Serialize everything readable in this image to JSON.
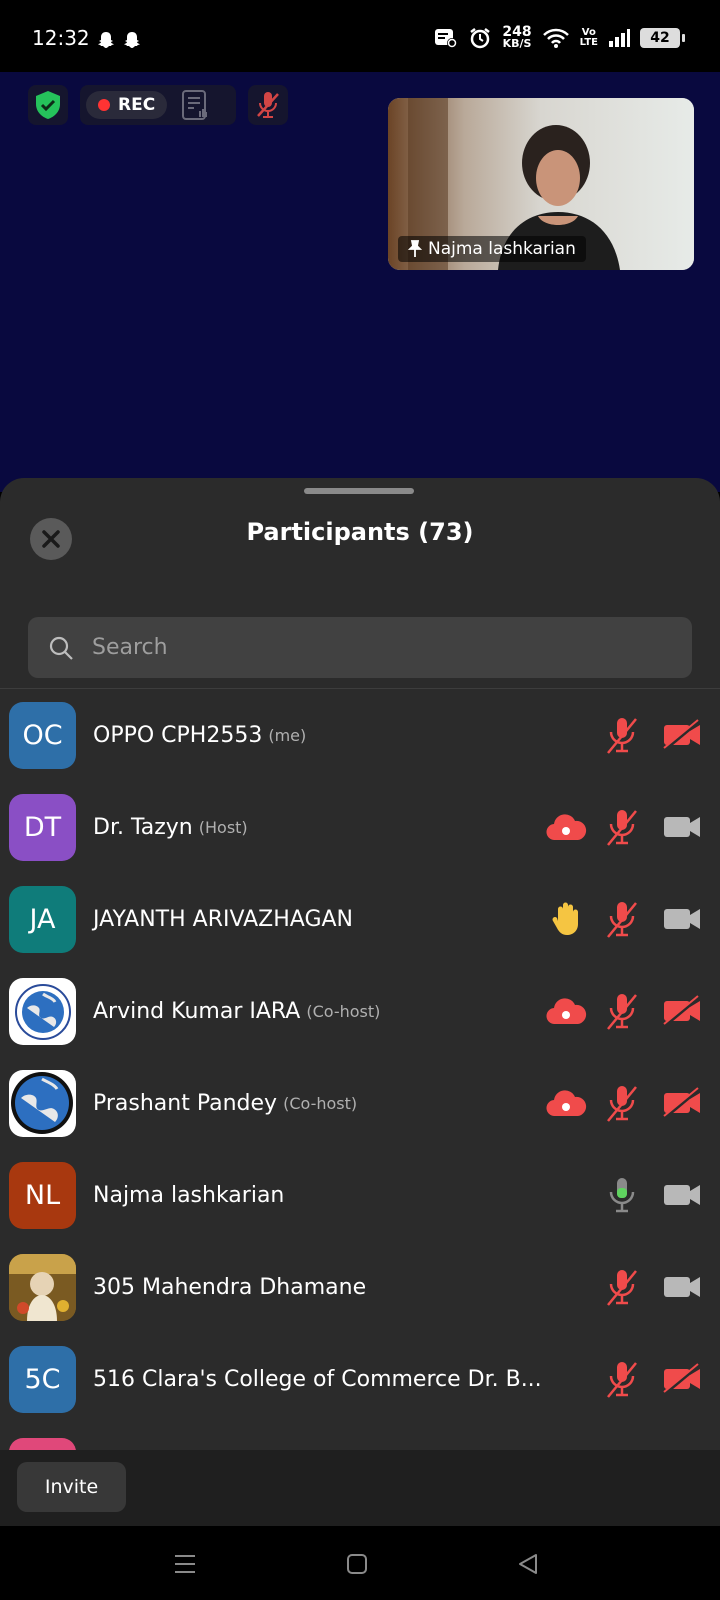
{
  "status_bar": {
    "time": "12:32",
    "net_speed": "248",
    "net_unit": "KB/S",
    "volte_top": "Vo",
    "volte_bottom": "LTE",
    "battery": "42"
  },
  "meeting": {
    "rec_label": "REC",
    "pinned_video_name": "Najma lashkarian"
  },
  "panel": {
    "title": "Participants (73)",
    "search_placeholder": "Search"
  },
  "participants": [
    {
      "initials": "OC",
      "name": "OPPO CPH2553",
      "role": "(me)",
      "avatar_color": "#2e6fa8",
      "mic": "muted",
      "cam": "off"
    },
    {
      "initials": "DT",
      "name": "Dr.  Tazyn",
      "role": "(Host)",
      "avatar_color": "#8a4fc5",
      "mic": "muted",
      "cam": "on",
      "extra": "cloud-record-icon"
    },
    {
      "initials": "JA",
      "name": "JAYANTH ARIVAZHAGAN",
      "role": "",
      "avatar_color": "#0f7c7a",
      "mic": "muted",
      "cam": "on",
      "extra": "raised-hand-icon"
    },
    {
      "initials": "",
      "name": "Arvind Kumar IARA",
      "role": "(Co-host)",
      "avatar_color": "#ffffff",
      "mic": "muted",
      "cam": "off",
      "extra": "cloud-record-icon"
    },
    {
      "initials": "",
      "name": "Prashant Pandey",
      "role": "(Co-host)",
      "avatar_color": "#ffffff",
      "mic": "muted",
      "cam": "off",
      "extra": "cloud-record-icon"
    },
    {
      "initials": "NL",
      "name": "Najma lashkarian",
      "role": "",
      "avatar_color": "#a8380f",
      "mic": "active",
      "cam": "on"
    },
    {
      "initials": "",
      "name": "305 Mahendra Dhamane",
      "role": "",
      "avatar_color": "#8a6a2a",
      "mic": "muted",
      "cam": "on"
    },
    {
      "initials": "5C",
      "name": "516 Clara's College of Commerce Dr.  B...",
      "role": "",
      "avatar_color": "#2e6fa8",
      "mic": "muted",
      "cam": "off"
    }
  ],
  "footer": {
    "invite_label": "Invite"
  },
  "colors": {
    "meeting_bg": "#09093f",
    "panel_bg": "#2b2b2b",
    "muted_red": "#f04b4b",
    "active_green": "#5fd35f",
    "cam_on_gray": "#b8b8b8",
    "raised_hand": "#f5c542"
  }
}
